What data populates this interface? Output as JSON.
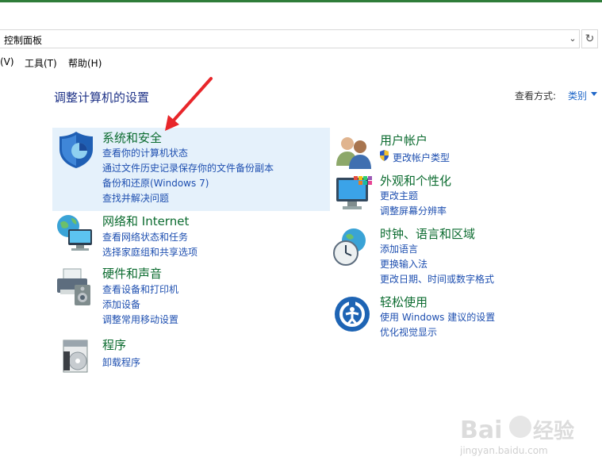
{
  "address": {
    "path": "控制面板",
    "dropdown_icon": "chevron-down-icon",
    "refresh_icon": "refresh-icon"
  },
  "menubar": [
    "(V)",
    "工具(T)",
    "帮助(H)"
  ],
  "page": {
    "title": "调整计算机的设置",
    "view_label": "查看方式:",
    "view_value": "类别"
  },
  "categories": {
    "system": {
      "title": "系统和安全",
      "icon": "shield-icon",
      "links": [
        "查看你的计算机状态",
        "通过文件历史记录保存你的文件备份副本",
        "备份和还原(Windows 7)",
        "查找并解决问题"
      ]
    },
    "network": {
      "title": "网络和 Internet",
      "icon": "network-icon",
      "links": [
        "查看网络状态和任务",
        "选择家庭组和共享选项"
      ]
    },
    "hardware": {
      "title": "硬件和声音",
      "icon": "printer-icon",
      "links": [
        "查看设备和打印机",
        "添加设备",
        "调整常用移动设置"
      ]
    },
    "programs": {
      "title": "程序",
      "icon": "programs-icon",
      "links": [
        "卸载程序"
      ]
    },
    "users": {
      "title": "用户帐户",
      "icon": "users-icon",
      "links": [
        "更改帐户类型"
      ]
    },
    "appearance": {
      "title": "外观和个性化",
      "icon": "monitor-icon",
      "links": [
        "更改主题",
        "调整屏幕分辨率"
      ]
    },
    "clock": {
      "title": "时钟、语言和区域",
      "icon": "clock-globe-icon",
      "links": [
        "添加语言",
        "更换输入法",
        "更改日期、时间或数字格式"
      ]
    },
    "ease": {
      "title": "轻松使用",
      "icon": "ease-of-access-icon",
      "links": [
        "使用 Windows 建议的设置",
        "优化视觉显示"
      ]
    }
  },
  "watermark": {
    "brand": "Baidu经验",
    "url": "jingyan.baidu.com"
  },
  "colors": {
    "title_green": "#0b6b2f",
    "link_blue": "#1e4fb0",
    "highlight": "#e5f1fb",
    "heading_blue": "#1e3287",
    "arrow_red": "#e8262a"
  }
}
